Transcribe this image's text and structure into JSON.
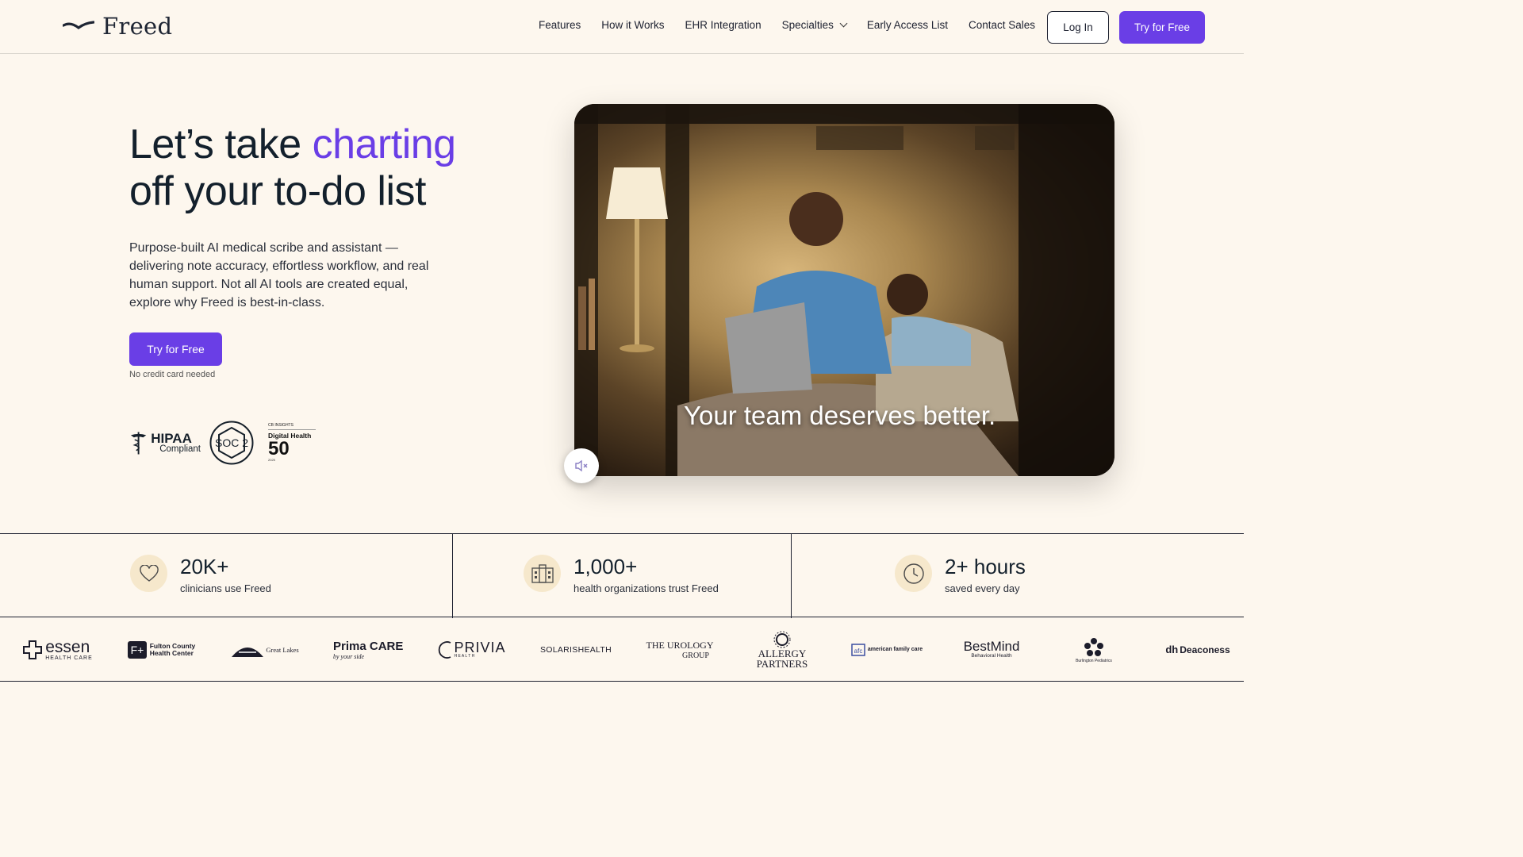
{
  "nav": {
    "brand": "Freed",
    "links": [
      "Features",
      "How it Works",
      "EHR Integration",
      "Specialties",
      "Early Access List",
      "Contact Sales"
    ],
    "login": "Log In",
    "try": "Try for Free"
  },
  "hero": {
    "headline_part1": "Let’s take ",
    "headline_accent": "charting",
    "headline_part2": "off your to-do list",
    "subcopy": "Purpose-built AI medical scribe and assistant — delivering note accuracy, effortless workflow, and real human support. Not all AI tools are created equal, explore why Freed is best-in-class.",
    "cta": "Try for Free",
    "note": "No credit card needed"
  },
  "badges": {
    "hipaa_title": "HIPAA",
    "hipaa_sub": "Compliant",
    "soc": "SOC 2",
    "dh_source": "CB INSIGHTS",
    "dh_title": "Digital Health",
    "dh_number": "50",
    "dh_year": "2025"
  },
  "video": {
    "caption": "Your team deserves better.",
    "mute_icon": "speaker-muted-icon"
  },
  "stats": [
    {
      "icon": "heart-icon",
      "number": "20K+",
      "label": "clinicians use Freed"
    },
    {
      "icon": "building-icon",
      "number": "1,000+",
      "label": "health organizations trust Freed"
    },
    {
      "icon": "clock-icon",
      "number": "2+ hours",
      "label": "saved every day"
    }
  ],
  "logos": {
    "essen": "essen",
    "essen_sub": "HEALTH CARE",
    "fulton": "Fulton County",
    "fulton2": "Health Center",
    "greatlakes": "Great Lakes",
    "prima": "Prima CARE",
    "prima_sub": "by your side",
    "privia": "PRIVIA",
    "privia_sub": "H E A L T H",
    "solaris": "SOLARISHEALTH",
    "urology": "THE UROLOGY",
    "urology2": "GROUP",
    "allergy": "ALLERGY",
    "allergy2": "PARTNERS",
    "afc": "american family care",
    "bestmind": "BestMind",
    "bestmind_sub": "Behavioral Health",
    "burlington": "Burlington Pediatrics",
    "deaconess": "Deaconess"
  },
  "colors": {
    "accent": "#6a3ee6",
    "background": "#fdf7ee",
    "stat_icon_bg": "#f6e8cc"
  }
}
